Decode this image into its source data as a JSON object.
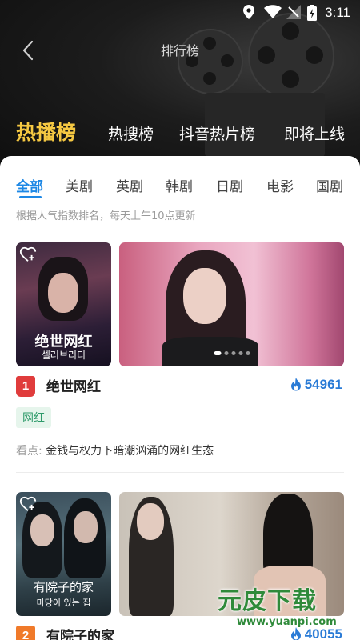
{
  "status_bar": {
    "time": "3:11"
  },
  "header": {
    "title": "排行榜"
  },
  "main_tabs": [
    {
      "label": "热播榜",
      "active": true
    },
    {
      "label": "热搜榜",
      "active": false
    },
    {
      "label": "抖音热片榜",
      "active": false
    },
    {
      "label": "即将上线",
      "active": false
    }
  ],
  "categories": [
    "全部",
    "美剧",
    "英剧",
    "韩剧",
    "日剧",
    "电影",
    "国剧"
  ],
  "active_category": "全部",
  "hint": "根据人气指数排名，每天上午10点更新",
  "items": [
    {
      "rank": "1",
      "rank_color": "#e03c3c",
      "name": "绝世网红",
      "heat": "54961",
      "tag": "网红",
      "point_label": "看点:",
      "point": "金钱与权力下暗潮汹涌的网红生态",
      "poster_title": "绝世网红",
      "poster_subtitle": "셀러브리티"
    },
    {
      "rank": "2",
      "rank_color": "#f07a2a",
      "name": "有院子的家",
      "heat": "40055",
      "poster_title": "有院子的家",
      "poster_subtitle": "마당이 있는 집"
    }
  ],
  "watermark": {
    "main": "元皮下载",
    "url": "www.yuanpi.com"
  },
  "colors": {
    "accent_blue": "#1e88e5",
    "gold": "#f5c842",
    "heat_blue": "#2a7bd6"
  }
}
